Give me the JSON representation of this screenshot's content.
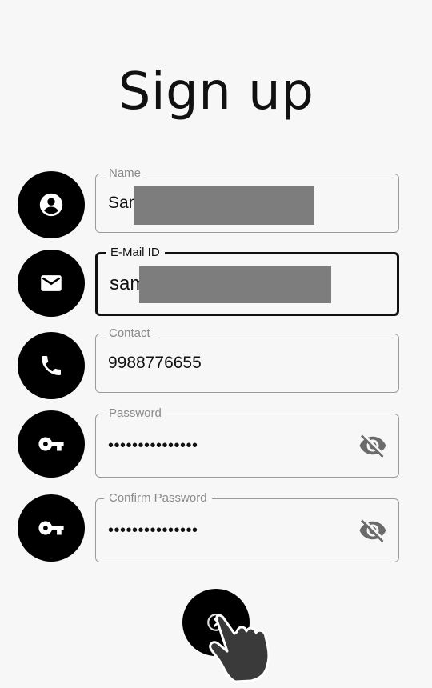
{
  "page": {
    "title": "Sign up"
  },
  "form": {
    "name": {
      "label": "Name",
      "value": "Sam",
      "icon": "account-circle-icon"
    },
    "email": {
      "label": "E-Mail ID",
      "value": "sam",
      "icon": "mail-icon"
    },
    "contact": {
      "label": "Contact",
      "value": "9988776655",
      "icon": "phone-icon"
    },
    "password": {
      "label": "Password",
      "value": "•••••••••••••••",
      "icon": "key-icon"
    },
    "confirm_password": {
      "label": "Confirm Password",
      "value": "•••••••••••••••",
      "icon": "key-icon"
    }
  },
  "submit": {
    "icon": "arrow-right-icon"
  },
  "colors": {
    "icon_bg": "#000000",
    "border": "#9b9b9b",
    "redaction": "#7d7d7d",
    "background": "#f7f7f7"
  }
}
